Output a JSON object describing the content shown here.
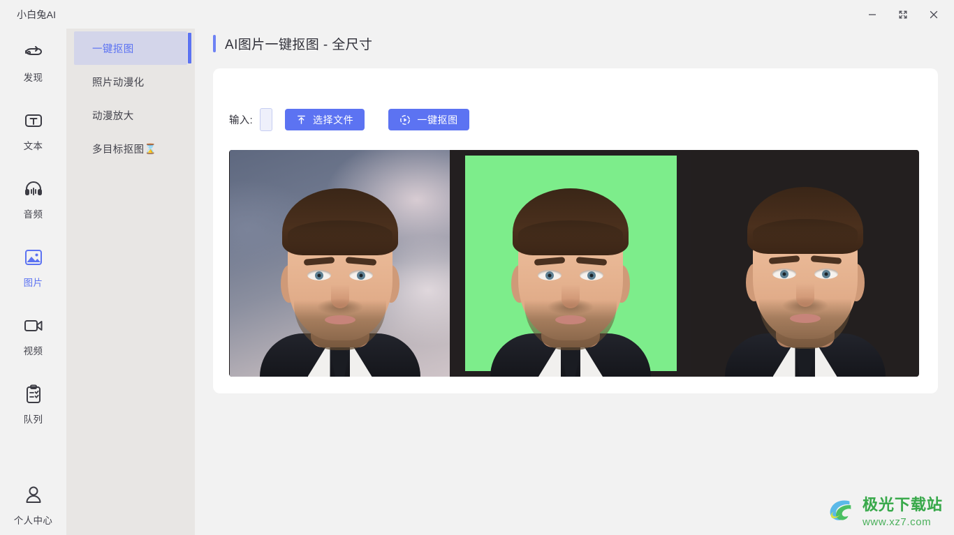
{
  "window": {
    "app_title": "小白兔AI",
    "controls": [
      {
        "name": "minimize",
        "label": "–"
      },
      {
        "name": "maximize",
        "label": "⤢"
      },
      {
        "name": "close",
        "label": "✕"
      }
    ]
  },
  "rail": {
    "items": [
      {
        "icon": "discover-icon",
        "label": "发现",
        "active": false
      },
      {
        "icon": "text-icon",
        "label": "文本",
        "active": false
      },
      {
        "icon": "audio-icon",
        "label": "音频",
        "active": false
      },
      {
        "icon": "image-icon",
        "label": "图片",
        "active": true
      },
      {
        "icon": "video-icon",
        "label": "视频",
        "active": false
      },
      {
        "icon": "queue-icon",
        "label": "队列",
        "active": false
      }
    ],
    "bottom_item": {
      "icon": "user-icon",
      "label": "个人中心"
    }
  },
  "menu": {
    "items": [
      {
        "label": "一键抠图",
        "selected": true,
        "badge": ""
      },
      {
        "label": "照片动漫化",
        "selected": false,
        "badge": ""
      },
      {
        "label": "动漫放大",
        "selected": false,
        "badge": ""
      },
      {
        "label": "多目标抠图",
        "selected": false,
        "badge": "⌛"
      }
    ]
  },
  "page": {
    "title": "AI图片一键抠图 - 全尺寸"
  },
  "toolbar": {
    "input_label": "输入:",
    "file_input_value": "",
    "file_input_placeholder": "",
    "select_file_button": "选择文件",
    "select_file_icon": "upload-icon",
    "run_button": "一键抠图",
    "run_icon": "play-circle-icon"
  },
  "preview": {
    "panes": [
      {
        "name": "original",
        "background": "#6f788e"
      },
      {
        "name": "green-screen",
        "background": "#7ded8b"
      },
      {
        "name": "dark-background",
        "background": "#231f1f"
      }
    ],
    "strip_background": "#231f20"
  },
  "watermark": {
    "name_cn": "极光下载站",
    "url": "www.xz7.com"
  },
  "colors": {
    "accent": "#5c73f2",
    "page_bg": "#f2f2f2",
    "menu_bg": "#e8e6e4",
    "menu_selected_bg": "#d3d5ea",
    "card_bg": "#ffffff"
  }
}
